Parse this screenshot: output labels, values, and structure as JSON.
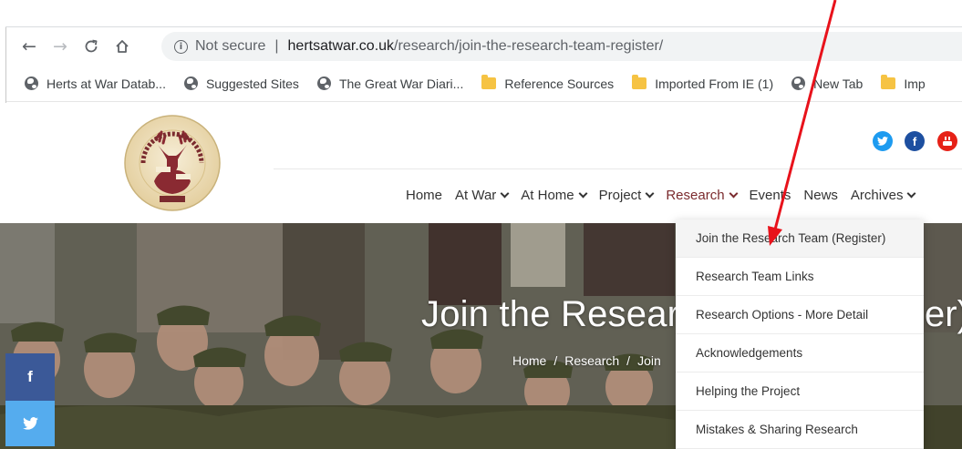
{
  "browser": {
    "security_label": "Not secure",
    "separator": "|",
    "url_domain": "hertsatwar.co.uk",
    "url_path": "/research/join-the-research-team-register/",
    "bookmarks": [
      {
        "label": "Herts at War Datab...",
        "icon": "globe-icon"
      },
      {
        "label": "Suggested Sites",
        "icon": "globe-icon"
      },
      {
        "label": "The Great War Diari...",
        "icon": "globe-icon"
      },
      {
        "label": "Reference Sources",
        "icon": "folder-icon"
      },
      {
        "label": "Imported From IE (1)",
        "icon": "folder-icon"
      },
      {
        "label": "New Tab",
        "icon": "globe-icon"
      },
      {
        "label": "Imp",
        "icon": "folder-icon"
      }
    ]
  },
  "nav": {
    "items": [
      {
        "label": "Home",
        "has_dropdown": false
      },
      {
        "label": "At War",
        "has_dropdown": true
      },
      {
        "label": "At Home",
        "has_dropdown": true
      },
      {
        "label": "Project",
        "has_dropdown": true
      },
      {
        "label": "Research",
        "has_dropdown": true
      },
      {
        "label": "Events",
        "has_dropdown": false
      },
      {
        "label": "News",
        "has_dropdown": false
      },
      {
        "label": "Archives",
        "has_dropdown": true
      }
    ]
  },
  "hero": {
    "title_visible": "Join the Researc",
    "title_end_visible": "er)",
    "breadcrumb": [
      "Home",
      "Research",
      "Join"
    ],
    "breadcrumb_separator": "/"
  },
  "dropdown": {
    "items": [
      "Join the Research Team (Register)",
      "Research Team Links",
      "Research Options - More Detail",
      "Acknowledgements",
      "Helping the Project",
      "Mistakes & Sharing Research"
    ]
  },
  "colors": {
    "accent": "#7b2b2e",
    "annotation_arrow": "#e8121b",
    "twitter": "#1d9bf0",
    "facebook": "#1d4fa0",
    "youtube": "#e62117",
    "share_facebook": "#3b5998",
    "share_twitter": "#55acee"
  }
}
